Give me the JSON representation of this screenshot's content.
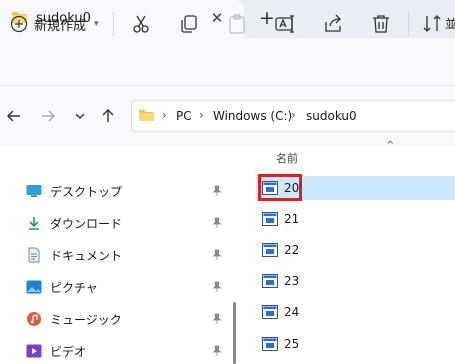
{
  "tab": {
    "title": "sudoku0",
    "close_glyph": "✕",
    "new_glyph": "+"
  },
  "commandbar": {
    "new_label": "新規作成",
    "sort_label": "並",
    "icons": [
      "cut-icon",
      "copy-icon",
      "paste-icon",
      "rename-icon",
      "share-icon",
      "delete-icon",
      "sort-icon"
    ]
  },
  "address": {
    "crumbs": [
      "PC",
      "Windows (C:)",
      "sudoku0"
    ],
    "separator": "›"
  },
  "nav": {
    "items": [
      {
        "label": "デスクトップ",
        "icon": "desktop-icon"
      },
      {
        "label": "ダウンロード",
        "icon": "download-icon"
      },
      {
        "label": "ドキュメント",
        "icon": "document-icon"
      },
      {
        "label": "ピクチャ",
        "icon": "pictures-icon"
      },
      {
        "label": "ミュージック",
        "icon": "music-icon"
      },
      {
        "label": "ビデオ",
        "icon": "video-icon"
      }
    ]
  },
  "content": {
    "column_name": "名前",
    "sort_caret": "^",
    "rows": [
      {
        "label": "20",
        "selected": true
      },
      {
        "label": "21",
        "selected": false
      },
      {
        "label": "22",
        "selected": false
      },
      {
        "label": "23",
        "selected": false
      },
      {
        "label": "24",
        "selected": false
      },
      {
        "label": "25",
        "selected": false
      }
    ]
  },
  "colors": {
    "selection": "#cde8fb",
    "highlight": "#e02020",
    "accent": "#0067c0"
  }
}
